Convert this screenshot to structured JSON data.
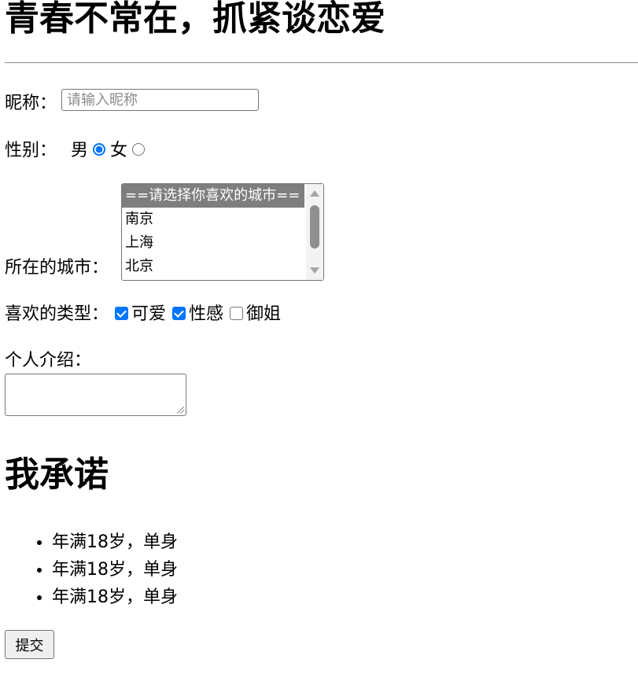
{
  "page": {
    "title": "青春不常在，抓紧谈恋爱"
  },
  "form": {
    "nickname": {
      "label": "昵称：",
      "value": "",
      "placeholder": "请输入昵称"
    },
    "gender": {
      "label": "性别：",
      "options": [
        {
          "label": "男",
          "checked": true
        },
        {
          "label": "女",
          "checked": false
        }
      ]
    },
    "city": {
      "label": "所在的城市：",
      "options": [
        {
          "label": "==请选择你喜欢的城市==",
          "selected": true
        },
        {
          "label": "南京",
          "selected": false
        },
        {
          "label": "上海",
          "selected": false
        },
        {
          "label": "北京",
          "selected": false
        }
      ]
    },
    "types": {
      "label": "喜欢的类型：",
      "options": [
        {
          "label": "可爱",
          "checked": true
        },
        {
          "label": "性感",
          "checked": true
        },
        {
          "label": "御姐",
          "checked": false
        }
      ]
    },
    "intro": {
      "label": "个人介绍：",
      "value": ""
    }
  },
  "promise": {
    "title": "我承诺",
    "items": [
      "年满18岁，单身",
      "年满18岁，单身",
      "年满18岁，单身"
    ]
  },
  "submit": {
    "label": "提交"
  },
  "colors": {
    "accent": "#0075ff",
    "selected_option_bg": "#7e7e7e"
  }
}
